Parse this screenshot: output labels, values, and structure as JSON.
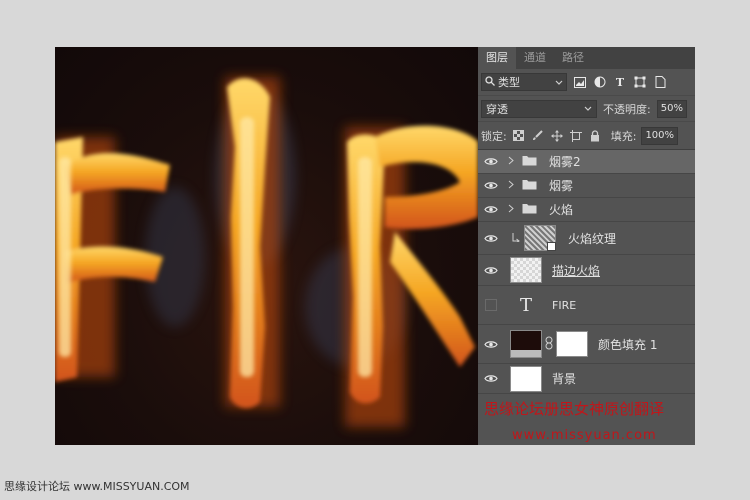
{
  "canvas": {
    "art_text": "FIRE"
  },
  "tabs": [
    {
      "label": "图层",
      "active": true
    },
    {
      "label": "通道",
      "active": false
    },
    {
      "label": "路径",
      "active": false
    }
  ],
  "filter": {
    "kind_label": "类型",
    "icons": [
      "image-filter-icon",
      "adjustment-filter-icon",
      "type-filter-icon",
      "shape-filter-icon",
      "smart-object-filter-icon"
    ]
  },
  "blend": {
    "mode": "穿透",
    "opacity_label": "不透明度:",
    "opacity_value": "50%"
  },
  "lock": {
    "label": "锁定:",
    "fill_label": "填充:",
    "fill_value": "100%"
  },
  "layers": [
    {
      "name": "烟雾2",
      "type": "group",
      "visible": true,
      "selected": true
    },
    {
      "name": "烟雾",
      "type": "group",
      "visible": true,
      "selected": false
    },
    {
      "name": "火焰",
      "type": "group",
      "visible": true,
      "selected": false
    },
    {
      "name": "火焰纹理",
      "type": "smart-clipped",
      "visible": true,
      "selected": false
    },
    {
      "name": "描边火焰",
      "type": "pixel",
      "visible": true,
      "selected": false
    },
    {
      "name": "FIRE",
      "type": "text",
      "visible": false,
      "selected": false
    },
    {
      "name": "颜色填充 1",
      "type": "fill",
      "visible": true,
      "selected": false,
      "fill_color": "#1d0c0a"
    },
    {
      "name": "背景",
      "type": "background",
      "visible": true,
      "selected": false
    }
  ],
  "watermark": {
    "line1": "思缘论坛册思女神原创翻译",
    "line2": "www.missyuan.com"
  },
  "footer": {
    "text": "思缘设计论坛 www.MISSYUAN.COM"
  },
  "colors": {
    "panel": "#535353",
    "tabbar": "#424242",
    "selected": "#666666",
    "watermark": "#c0161a",
    "fire": "#f5a623"
  }
}
